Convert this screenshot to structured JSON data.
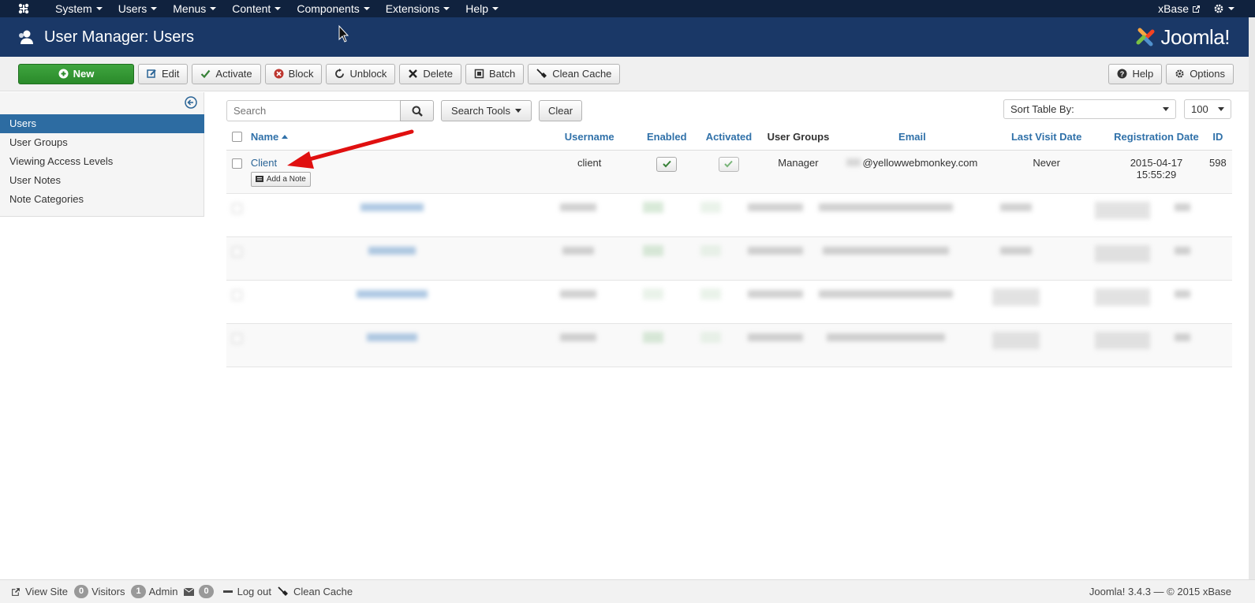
{
  "topnav": {
    "menus": [
      "System",
      "Users",
      "Menus",
      "Content",
      "Components",
      "Extensions",
      "Help"
    ],
    "site_name": "xBase",
    "settings_icon": "gear-icon"
  },
  "header": {
    "title": "User Manager: Users",
    "brand": "Joomla!",
    "icon": "users-icon"
  },
  "toolbar": {
    "new_label": "New",
    "edit_label": "Edit",
    "activate_label": "Activate",
    "block_label": "Block",
    "unblock_label": "Unblock",
    "delete_label": "Delete",
    "batch_label": "Batch",
    "clean_cache_label": "Clean Cache",
    "help_label": "Help",
    "options_label": "Options"
  },
  "sidebar": {
    "items": [
      {
        "label": "Users",
        "active": true
      },
      {
        "label": "User Groups",
        "active": false
      },
      {
        "label": "Viewing Access Levels",
        "active": false
      },
      {
        "label": "User Notes",
        "active": false
      },
      {
        "label": "Note Categories",
        "active": false
      }
    ]
  },
  "filters": {
    "search_placeholder": "Search",
    "search_tools_label": "Search Tools",
    "clear_label": "Clear",
    "sort_label": "Sort Table By:",
    "limit_value": "100"
  },
  "table": {
    "headers": {
      "name": "Name",
      "username": "Username",
      "enabled": "Enabled",
      "activated": "Activated",
      "user_groups": "User Groups",
      "email": "Email",
      "last_visit": "Last Visit Date",
      "registration": "Registration Date",
      "id": "ID"
    },
    "first_row": {
      "name": "Client",
      "add_note": "Add a Note",
      "username": "client",
      "user_group": "Manager",
      "email": "@yellowwebmonkey.com",
      "last_visit": "Never",
      "reg_date": "2015-04-17",
      "reg_time": "15:55:29",
      "id": "598"
    }
  },
  "statusbar": {
    "view_site": "View Site",
    "visitors_count": "0",
    "visitors_label": "Visitors",
    "admin_count": "1",
    "admin_label": "Admin",
    "messages_count": "0",
    "logout_label": "Log out",
    "clean_cache_label": "Clean Cache",
    "footer": "Joomla! 3.4.3 — © 2015 xBase"
  }
}
